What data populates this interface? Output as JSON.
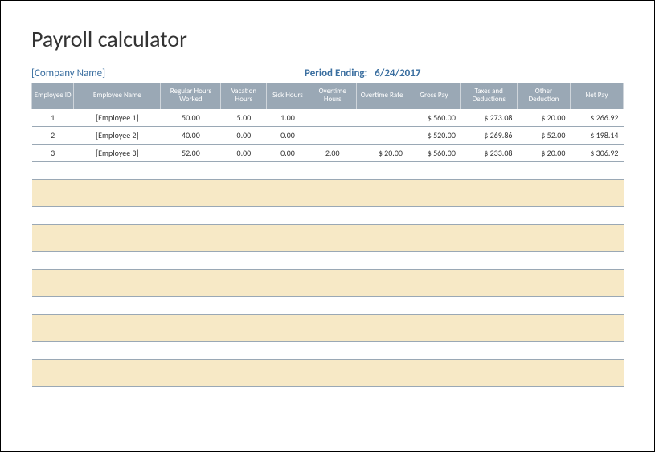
{
  "title": "Payroll calculator",
  "company": "[Company Name]",
  "period_label": "Period Ending:",
  "period_date": "6/24/2017",
  "columns": [
    "Employee ID",
    "Employee Name",
    "Regular Hours Worked",
    "Vacation Hours",
    "Sick Hours",
    "Overtime Hours",
    "Overtime Rate",
    "Gross Pay",
    "Taxes and Deductions",
    "Other Deduction",
    "Net Pay"
  ],
  "rows": [
    {
      "id": "1",
      "name": "[Employee 1]",
      "reg": "50.00",
      "vac": "5.00",
      "sick": "1.00",
      "ot_hours": "",
      "ot_rate": "",
      "gross": "$  560.00",
      "tax": "$  273.08",
      "other": "$    20.00",
      "net": "$  266.92"
    },
    {
      "id": "2",
      "name": "[Employee 2]",
      "reg": "40.00",
      "vac": "0.00",
      "sick": "0.00",
      "ot_hours": "",
      "ot_rate": "",
      "gross": "$  520.00",
      "tax": "$  269.86",
      "other": "$    52.00",
      "net": "$  198.14"
    },
    {
      "id": "3",
      "name": "[Employee 3]",
      "reg": "52.00",
      "vac": "0.00",
      "sick": "0.00",
      "ot_hours": "2.00",
      "ot_rate": "$    20.00",
      "gross": "$  560.00",
      "tax": "$  233.08",
      "other": "$    20.00",
      "net": "$  306.92"
    }
  ],
  "chart_data": {
    "type": "table",
    "title": "Payroll calculator",
    "columns": [
      "Employee ID",
      "Employee Name",
      "Regular Hours Worked",
      "Vacation Hours",
      "Sick Hours",
      "Overtime Hours",
      "Overtime Rate",
      "Gross Pay",
      "Taxes and Deductions",
      "Other Deduction",
      "Net Pay"
    ],
    "rows": [
      [
        1,
        "[Employee 1]",
        50.0,
        5.0,
        1.0,
        null,
        null,
        560.0,
        273.08,
        20.0,
        266.92
      ],
      [
        2,
        "[Employee 2]",
        40.0,
        0.0,
        0.0,
        null,
        null,
        520.0,
        269.86,
        52.0,
        198.14
      ],
      [
        3,
        "[Employee 3]",
        52.0,
        0.0,
        0.0,
        2.0,
        20.0,
        560.0,
        233.08,
        20.0,
        306.92
      ]
    ]
  }
}
